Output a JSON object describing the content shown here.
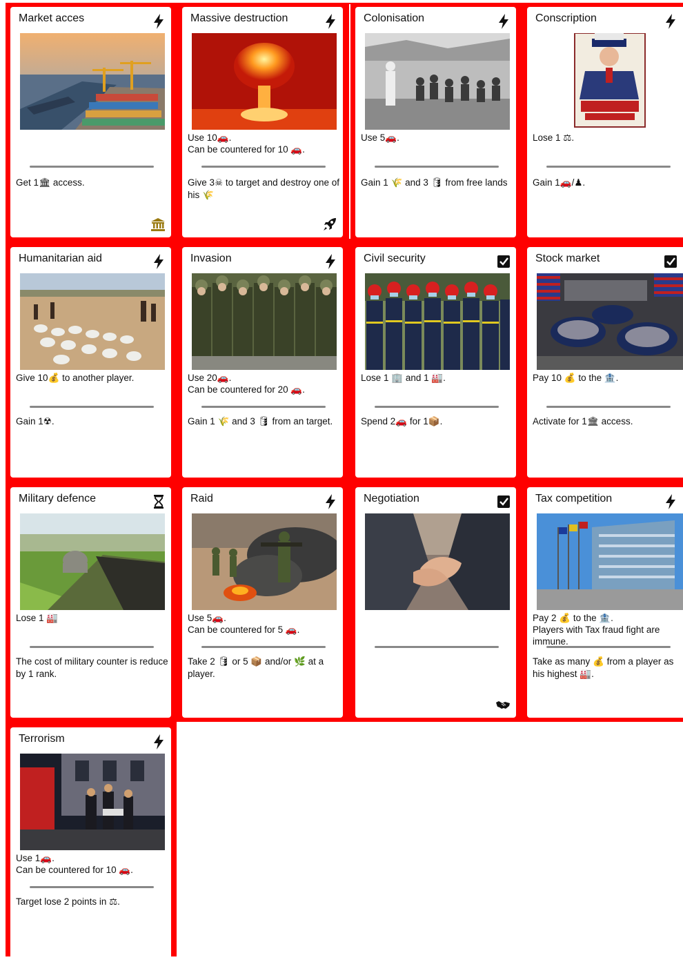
{
  "colors": {
    "frame": "#ff0000",
    "divider": "#888888"
  },
  "cards": [
    {
      "title": "Market acces",
      "type_icon": "lightning-icon",
      "art": "harbour-containers",
      "top_text": "",
      "bottom_text": "Get 1🏛 access.",
      "corner_icon": "bank-icon"
    },
    {
      "title": "Massive destruction",
      "type_icon": "lightning-icon",
      "art": "nuclear-explosion",
      "top_text": "Use 10🚗.\n Can be countered for 10 🚗.",
      "bottom_text": "Give 3☠ to target and destroy one of his 🌾",
      "corner_icon": "rocket-icon"
    },
    {
      "title": "Colonisation",
      "type_icon": "lightning-icon",
      "art": "colonial-photo",
      "top_text": "Use 5🚗.",
      "bottom_text": "Gain 1 🌾 and 3 🛢 from free lands",
      "corner_icon": ""
    },
    {
      "title": "Conscription",
      "type_icon": "lightning-icon",
      "art": "uncle-sam-poster",
      "top_text": "Lose 1 ⚖.",
      "bottom_text": "Gain 1🚗/♟.",
      "corner_icon": ""
    },
    {
      "title": "Humanitarian aid",
      "type_icon": "lightning-icon",
      "art": "aid-sacks",
      "top_text": "Give 10💰 to another player.",
      "bottom_text": "Gain 1☢.",
      "corner_icon": ""
    },
    {
      "title": "Invasion",
      "type_icon": "lightning-icon",
      "art": "soldiers-march",
      "top_text": "Use 20🚗.\n Can be countered for 20 🚗.",
      "bottom_text": "Gain 1 🌾 and 3 🛢 from an target.",
      "corner_icon": ""
    },
    {
      "title": "Civil security",
      "type_icon": "checkbox-icon",
      "art": "firefighters",
      "top_text": "Lose 1 🏢 and 1 🏭.",
      "bottom_text": "Spend 2🚗 for 1📦.",
      "corner_icon": ""
    },
    {
      "title": "Stock market",
      "type_icon": "checkbox-icon",
      "art": "stock-exchange",
      "top_text": "Pay 10 💰 to the 🏦.",
      "bottom_text": "Activate for 1🏛 access.",
      "corner_icon": ""
    },
    {
      "title": "Military defence",
      "type_icon": "hourglass-icon",
      "art": "bunker",
      "top_text": "Lose 1 🏭",
      "bottom_text": "The cost of military counter is reduce by 1 rank.",
      "corner_icon": ""
    },
    {
      "title": "Raid",
      "type_icon": "lightning-icon",
      "art": "raid-soldiers",
      "top_text": "Use 5🚗.\n Can be countered for 5 🚗.",
      "bottom_text": "Take 2 🛢 or 5 📦 and/or 🌿 at a player.",
      "corner_icon": ""
    },
    {
      "title": "Negotiation",
      "type_icon": "checkbox-icon",
      "art": "handshake",
      "top_text": "",
      "bottom_text": "",
      "corner_icon": "handshake-icon"
    },
    {
      "title": "Tax competition",
      "type_icon": "lightning-icon",
      "art": "eu-parliament",
      "top_text": "Pay 2 💰 to the 🏦.\n Players with Tax fraud fight are immune.",
      "bottom_text": "Take as many 💰 from a player as his highest 🏭.",
      "corner_icon": ""
    },
    {
      "title": "Terrorism",
      "type_icon": "lightning-icon",
      "art": "night-street-attack",
      "top_text": "Use 1🚗.\n Can be countered for 10 🚗.",
      "bottom_text": "Target lose 2 points in ⚖.",
      "corner_icon": ""
    }
  ]
}
